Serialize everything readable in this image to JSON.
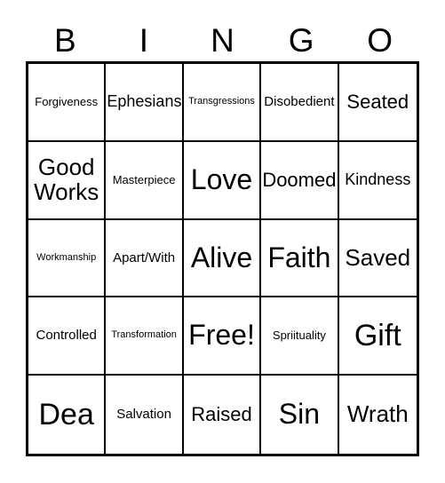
{
  "card": {
    "title": "BINGO",
    "background_color": "#ffffff",
    "text_color": "#000000",
    "border_color": "#000000"
  },
  "header": {
    "letters": [
      "B",
      "I",
      "N",
      "G",
      "O"
    ]
  },
  "grid": {
    "columns": 5,
    "rows": 5,
    "cells": [
      [
        {
          "label": "Forgiveness",
          "size": "s"
        },
        {
          "label": "Ephesians",
          "size": "l"
        },
        {
          "label": "Transgressions",
          "size": "xs"
        },
        {
          "label": "Disobedient",
          "size": "m"
        },
        {
          "label": "Seated",
          "size": "xl"
        }
      ],
      [
        {
          "label": "Good Works",
          "size": "xxl"
        },
        {
          "label": "Masterpiece",
          "size": "s"
        },
        {
          "label": "Love",
          "size": "huge"
        },
        {
          "label": "Doomed",
          "size": "xl"
        },
        {
          "label": "Kindness",
          "size": "l"
        }
      ],
      [
        {
          "label": "Workmanship",
          "size": "xs"
        },
        {
          "label": "Apart/With",
          "size": "m"
        },
        {
          "label": "Alive",
          "size": "huge"
        },
        {
          "label": "Faith",
          "size": "huge"
        },
        {
          "label": "Saved",
          "size": "xxl"
        }
      ],
      [
        {
          "label": "Controlled",
          "size": "m"
        },
        {
          "label": "Transformation",
          "size": "xs"
        },
        {
          "label": "Free!",
          "size": "huge"
        },
        {
          "label": "Spriituality",
          "size": "s"
        },
        {
          "label": "Gift",
          "size": "max"
        }
      ],
      [
        {
          "label": "Dea",
          "size": "max"
        },
        {
          "label": "Salvation",
          "size": "m"
        },
        {
          "label": "Raised",
          "size": "xl"
        },
        {
          "label": "Sin",
          "size": "huge"
        },
        {
          "label": "Wrath",
          "size": "xxl"
        }
      ]
    ]
  }
}
